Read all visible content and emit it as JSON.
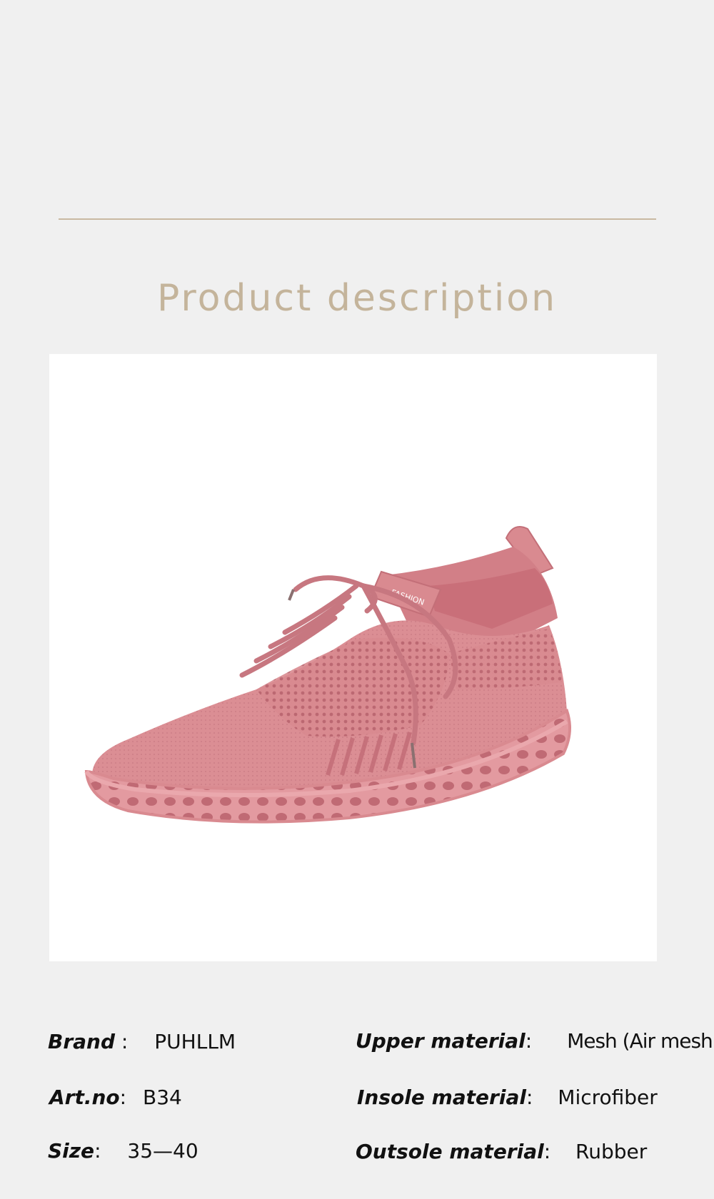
{
  "section_title": "Product description",
  "specs_left": [
    {
      "label": "Brand",
      "sep": " :",
      "value": "PUHLLM"
    },
    {
      "label": "Art.no",
      "sep": ":",
      "value": "B34"
    },
    {
      "label": "Size",
      "sep": ":",
      "value": "35—40"
    }
  ],
  "specs_right": [
    {
      "label": "Upper material",
      "sep": ":",
      "value": "Mesh (Air mesh)"
    },
    {
      "label": "Insole material",
      "sep": ":",
      "value": "Microfiber"
    },
    {
      "label": "Outsole material",
      "sep": ":",
      "value": "Rubber"
    }
  ],
  "product_image": {
    "tongue_tag": "FASHION",
    "colors": {
      "shoe": "#d98a90",
      "shoe_dark": "#c36f78",
      "shoe_light": "#e8a8ac",
      "accent": "#c4b49b"
    }
  }
}
